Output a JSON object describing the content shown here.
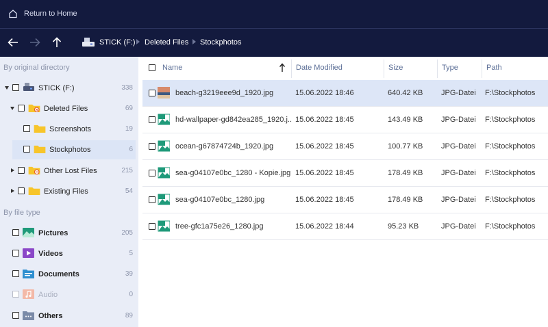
{
  "topbar": {
    "home_label": "Return to Home"
  },
  "breadcrumb": [
    "STICK (F:)",
    "Deleted Files",
    "Stockphotos"
  ],
  "sidebar": {
    "section_directory": "By original directory",
    "tree": [
      {
        "label": "STICK (F:)",
        "count": "338"
      },
      {
        "label": "Deleted Files",
        "count": "69"
      },
      {
        "label": "Screenshots",
        "count": "19"
      },
      {
        "label": "Stockphotos",
        "count": "6"
      },
      {
        "label": "Other Lost Files",
        "count": "215"
      },
      {
        "label": "Existing Files",
        "count": "54"
      }
    ],
    "section_filetype": "By file type",
    "types": [
      {
        "label": "Pictures",
        "count": "205",
        "color": "#1f9a7a"
      },
      {
        "label": "Videos",
        "count": "5",
        "color": "#8b47c8"
      },
      {
        "label": "Documents",
        "count": "39",
        "color": "#2e8fd0"
      },
      {
        "label": "Audio",
        "count": "0",
        "color": "#f0b0a0"
      },
      {
        "label": "Others",
        "count": "89",
        "color": "#7a8aa8"
      }
    ]
  },
  "table": {
    "headers": {
      "name": "Name",
      "date": "Date Modified",
      "size": "Size",
      "type": "Type",
      "path": "Path"
    },
    "rows": [
      {
        "name": "beach-g3219eee9d_1920.jpg",
        "date": "15.06.2022 18:46",
        "size": "640.42 KB",
        "type": "JPG-Datei",
        "path": "F:\\Stockphotos"
      },
      {
        "name": "hd-wallpaper-gd842ea285_1920.j...",
        "date": "15.06.2022 18:45",
        "size": "143.49 KB",
        "type": "JPG-Datei",
        "path": "F:\\Stockphotos"
      },
      {
        "name": "ocean-g67874724b_1920.jpg",
        "date": "15.06.2022 18:45",
        "size": "100.77 KB",
        "type": "JPG-Datei",
        "path": "F:\\Stockphotos"
      },
      {
        "name": "sea-g04107e0bc_1280 - Kopie.jpg",
        "date": "15.06.2022 18:45",
        "size": "178.49 KB",
        "type": "JPG-Datei",
        "path": "F:\\Stockphotos"
      },
      {
        "name": "sea-g04107e0bc_1280.jpg",
        "date": "15.06.2022 18:45",
        "size": "178.49 KB",
        "type": "JPG-Datei",
        "path": "F:\\Stockphotos"
      },
      {
        "name": "tree-gfc1a75e26_1280.jpg",
        "date": "15.06.2022 18:44",
        "size": "95.23 KB",
        "type": "JPG-Datei",
        "path": "F:\\Stockphotos"
      }
    ]
  },
  "colors": {
    "header_bg": "#131a3e",
    "sidebar_bg": "#e9edf7",
    "selected_bg": "#dde6f7",
    "folder": "#f7c52b"
  }
}
